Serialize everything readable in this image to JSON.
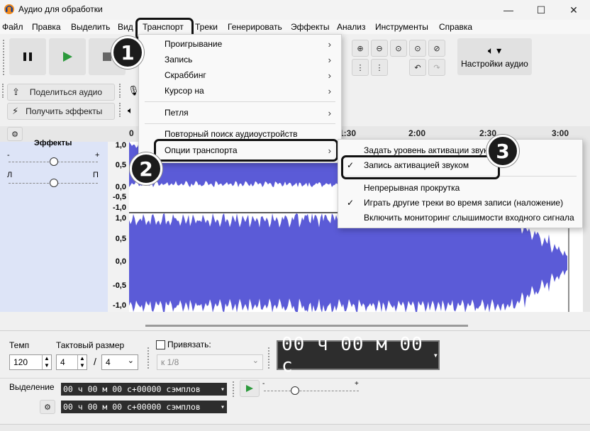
{
  "window": {
    "title": "Аудио для обработки",
    "minimize_glyph": "—",
    "maximize_glyph": "☐",
    "close_glyph": "✕"
  },
  "menubar": {
    "items": [
      "Файл",
      "Правка",
      "Выделить",
      "Вид",
      "Транспорт",
      "Треки",
      "Генерировать",
      "Эффекты",
      "Анализ",
      "Инструменты",
      "Справка"
    ]
  },
  "toolbar": {
    "audio_settings": "Настройки аудио",
    "share_audio": "Поделиться аудио",
    "get_effects": "Получить эффекты"
  },
  "timeline": {
    "ticks": [
      "0",
      "1:30",
      "2:00",
      "2:30",
      "3:00"
    ]
  },
  "track": {
    "effects_label": "Эффекты",
    "gain_minus": "-",
    "gain_plus": "+",
    "pan_left": "Л",
    "pan_right": "П",
    "scale_labels": [
      "1,0",
      "0,5",
      "0,0",
      "-0,5",
      "-1,0",
      "1,0",
      "0,5",
      "0,0",
      "-0,5",
      "-1,0"
    ]
  },
  "transport_menu": {
    "items": [
      {
        "label": "Проигрывание",
        "submenu": "›"
      },
      {
        "label": "Запись",
        "submenu": "›"
      },
      {
        "label": "Скраббинг",
        "submenu": "›"
      },
      {
        "label": "Курсор на",
        "submenu": "›"
      },
      {
        "label": "Петля",
        "submenu": "›"
      },
      {
        "label": "Повторный поиск аудиоустройств",
        "submenu": ""
      },
      {
        "label": "Опции транспорта",
        "submenu": "›"
      }
    ]
  },
  "options_submenu": {
    "items": [
      {
        "label": "Задать уровень активации звуком...",
        "checked": false,
        "check": ""
      },
      {
        "label": "Запись активацией звуком",
        "checked": true,
        "check": "✓"
      },
      {
        "label": "Непрерывная прокрутка",
        "checked": false,
        "check": ""
      },
      {
        "label": "Играть другие треки во время записи (наложение)",
        "checked": true,
        "check": "✓"
      },
      {
        "label": "Включить мониторинг слышимости входного сигнала",
        "checked": false,
        "check": ""
      }
    ]
  },
  "badges": [
    "1",
    "2",
    "3"
  ],
  "bottom": {
    "tempo_label": "Темп",
    "tempo_value": "120",
    "time_sig_label": "Тактовый размер",
    "time_sig_num": "4",
    "time_sig_slash": "/",
    "time_sig_den": "4",
    "snap_label": "Привязать:",
    "snap_value": "к 1/8",
    "big_time": "00 ч 00 м 00 с",
    "selection_label": "Выделение",
    "sel_start": "00 ч 00 м 00 с+00000 сэмплов",
    "sel_end": "00 ч 00 м 00 с+00000 сэмплов",
    "vol_minus": "-",
    "vol_plus": "+"
  },
  "colors": {
    "waveform": "#5b5bd7",
    "track_panel": "#dde4f7",
    "menu_bg": "#f9f9f9"
  }
}
